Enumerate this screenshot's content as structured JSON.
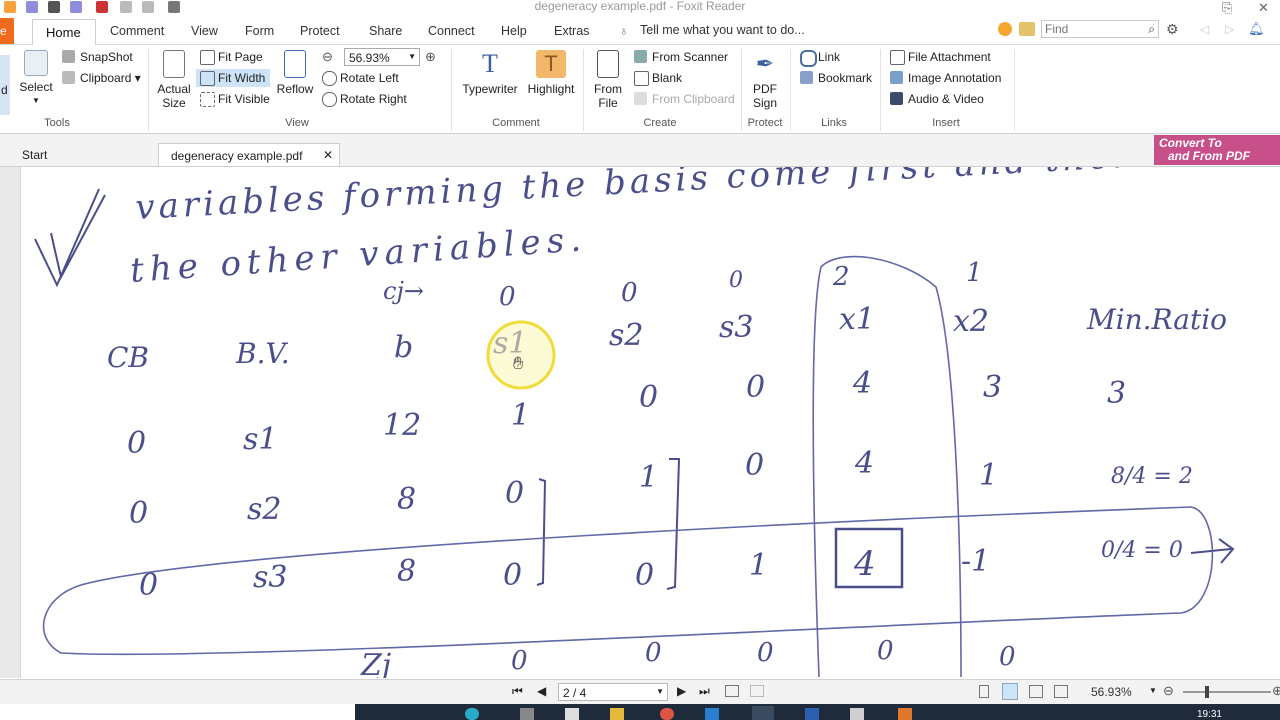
{
  "window": {
    "title": "degeneracy example.pdf - Foxit Reader"
  },
  "menu": {
    "file_label": "e",
    "items": [
      "Home",
      "Comment",
      "View",
      "Form",
      "Protect",
      "Share",
      "Connect",
      "Help",
      "Extras"
    ],
    "tell_me": "Tell me what you want to do...",
    "find_placeholder": "Find"
  },
  "ribbon": {
    "tools": {
      "label": "Tools",
      "select": "Select",
      "snapshot": "SnapShot",
      "clipboard": "Clipboard",
      "partial_left": "d"
    },
    "view": {
      "label": "View",
      "actual_size_1": "Actual",
      "actual_size_2": "Size",
      "fit_page": "Fit Page",
      "fit_width": "Fit Width",
      "fit_visible": "Fit Visible",
      "reflow": "Reflow",
      "zoom_value": "56.93%",
      "rotate_left": "Rotate Left",
      "rotate_right": "Rotate Right"
    },
    "comment": {
      "label": "Comment",
      "typewriter": "Typewriter",
      "highlight": "Highlight"
    },
    "create": {
      "label": "Create",
      "from_file_1": "From",
      "from_file_2": "File",
      "from_scanner": "From Scanner",
      "blank": "Blank",
      "from_clipboard": "From Clipboard"
    },
    "protect": {
      "label": "Protect",
      "pdf_sign_1": "PDF",
      "pdf_sign_2": "Sign"
    },
    "links": {
      "label": "Links",
      "link": "Link",
      "bookmark": "Bookmark"
    },
    "insert": {
      "label": "Insert",
      "file_attachment": "File Attachment",
      "image_annotation": "Image Annotation",
      "audio_video": "Audio & Video"
    }
  },
  "tabs": {
    "start": "Start",
    "document": "degeneracy example.pdf",
    "convert_1": "Convert To",
    "convert_2": "and From PDF"
  },
  "page_content": {
    "line1": "variables forming the basis come first and then",
    "line2": "the other variables.",
    "cj_label": "cj→",
    "cj_values": [
      "0",
      "0",
      "0",
      "2",
      "1"
    ],
    "headers": [
      "CB",
      "B.V.",
      "b",
      "s1",
      "s2",
      "s3",
      "x1",
      "x2",
      "Min.Ratio"
    ],
    "rows": [
      [
        "0",
        "s1",
        "12",
        "1",
        "0",
        "0",
        "4",
        "3",
        "3"
      ],
      [
        "0",
        "s2",
        "8",
        "0",
        "1",
        "0",
        "4",
        "1",
        "8/4 = 2"
      ],
      [
        "0",
        "s3",
        "8",
        "0",
        "0",
        "1",
        "4",
        "-1",
        "0/4 = 0"
      ]
    ],
    "zj_label": "Zj",
    "zj_values": [
      "0",
      "0",
      "0",
      "0",
      "0"
    ]
  },
  "status": {
    "page": "2 / 4",
    "zoom": "56.93%"
  },
  "taskbar": {
    "time": "19:31"
  }
}
